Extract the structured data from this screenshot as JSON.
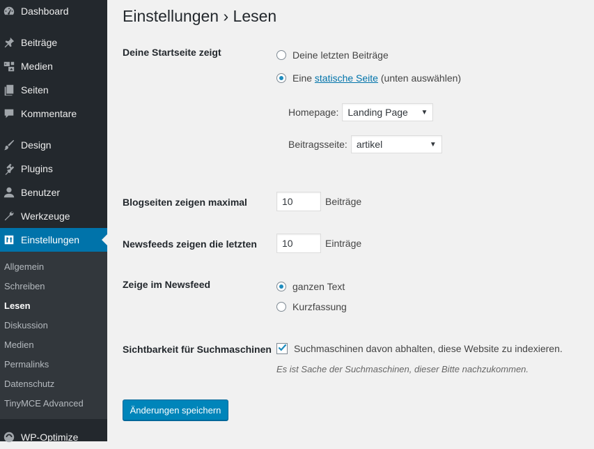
{
  "sidebar": {
    "items": [
      {
        "label": "Dashboard",
        "icon": "dashboard-icon"
      },
      {
        "label": "Beiträge",
        "icon": "pin-icon"
      },
      {
        "label": "Medien",
        "icon": "media-icon"
      },
      {
        "label": "Seiten",
        "icon": "pages-icon"
      },
      {
        "label": "Kommentare",
        "icon": "comment-icon"
      },
      {
        "label": "Design",
        "icon": "brush-icon"
      },
      {
        "label": "Plugins",
        "icon": "plugin-icon"
      },
      {
        "label": "Benutzer",
        "icon": "user-icon"
      },
      {
        "label": "Werkzeuge",
        "icon": "wrench-icon"
      },
      {
        "label": "Einstellungen",
        "icon": "settings-icon"
      },
      {
        "label": "WP-Optimize",
        "icon": "optimize-icon"
      }
    ],
    "submenu": [
      "Allgemein",
      "Schreiben",
      "Lesen",
      "Diskussion",
      "Medien",
      "Permalinks",
      "Datenschutz",
      "TinyMCE Advanced"
    ],
    "current_submenu": "Lesen",
    "accent_color": "#0073aa"
  },
  "page": {
    "title": "Einstellungen › Lesen"
  },
  "front_page": {
    "label": "Deine Startseite zeigt",
    "option_posts": "Deine letzten Beiträge",
    "option_static_prefix": "Eine",
    "option_static_link": "statische Seite",
    "option_static_suffix": "(unten auswählen)",
    "selected": "static",
    "homepage_label": "Homepage:",
    "homepage_value": "Landing Page",
    "posts_page_label": "Beitragsseite:",
    "posts_page_value": "artikel"
  },
  "blog_pages": {
    "label": "Blogseiten zeigen maximal",
    "value": "10",
    "unit": "Beiträge"
  },
  "newsfeeds": {
    "label": "Newsfeeds zeigen die letzten",
    "value": "10",
    "unit": "Einträge"
  },
  "feed_content": {
    "label": "Zeige im Newsfeed",
    "option_full": "ganzen Text",
    "option_summary": "Kurzfassung",
    "selected": "full"
  },
  "search_visibility": {
    "label": "Sichtbarkeit für Suchmaschinen",
    "checkbox_label": "Suchmaschinen davon abhalten, diese Website zu indexieren.",
    "checked": true,
    "description": "Es ist Sache der Suchmaschinen, dieser Bitte nachzukommen."
  },
  "save_button": "Änderungen speichern"
}
